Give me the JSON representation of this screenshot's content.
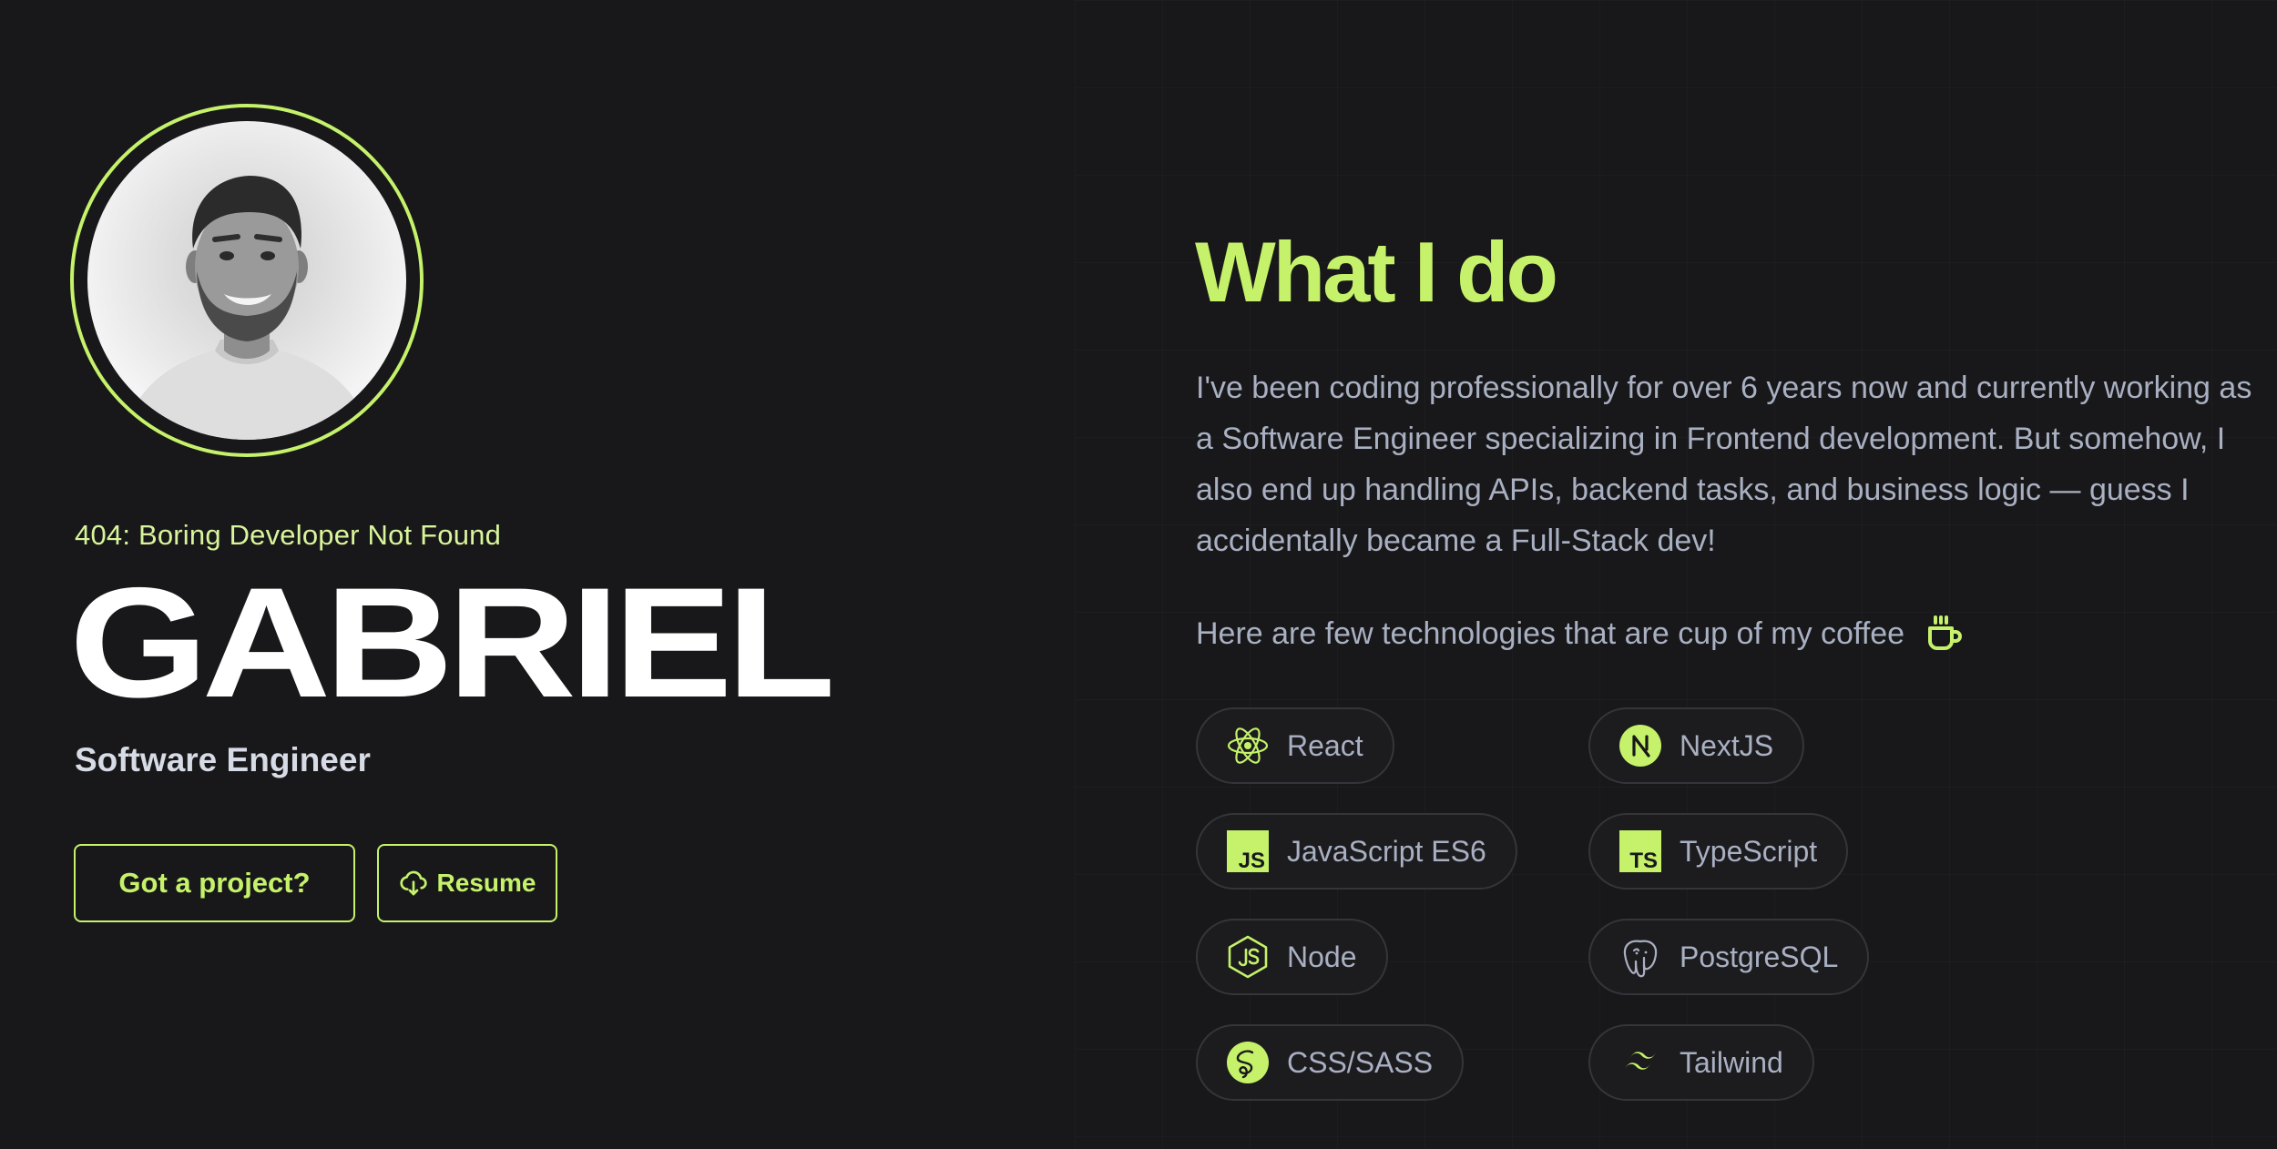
{
  "hero": {
    "tagline": "404: Boring Developer Not Found",
    "name": "GABRIEL",
    "role": "Software Engineer",
    "project_button": "Got a project?",
    "resume_button": "Resume"
  },
  "about": {
    "title": "What I do",
    "intro": "I've been coding professionally for over 6 years now and currently working as a Software Engineer specializing in Frontend development. But somehow, I also end up handling APIs, backend tasks, and business logic — guess I accidentally became a Full-Stack dev!",
    "tech_intro": "Here are few technologies that are cup of my coffee"
  },
  "technologies": [
    {
      "label": "React",
      "icon": "react-icon"
    },
    {
      "label": "NextJS",
      "icon": "nextjs-icon"
    },
    {
      "label": "JavaScript ES6",
      "icon": "javascript-icon"
    },
    {
      "label": "TypeScript",
      "icon": "typescript-icon"
    },
    {
      "label": "Node",
      "icon": "nodejs-icon"
    },
    {
      "label": "PostgreSQL",
      "icon": "postgresql-icon"
    },
    {
      "label": "CSS/SASS",
      "icon": "sass-icon"
    },
    {
      "label": "Tailwind",
      "icon": "tailwind-icon"
    }
  ],
  "colors": {
    "background": "#18181a",
    "accent": "#c5f26a",
    "text_muted": "#a9b0c2",
    "chip_border": "#34353a"
  }
}
